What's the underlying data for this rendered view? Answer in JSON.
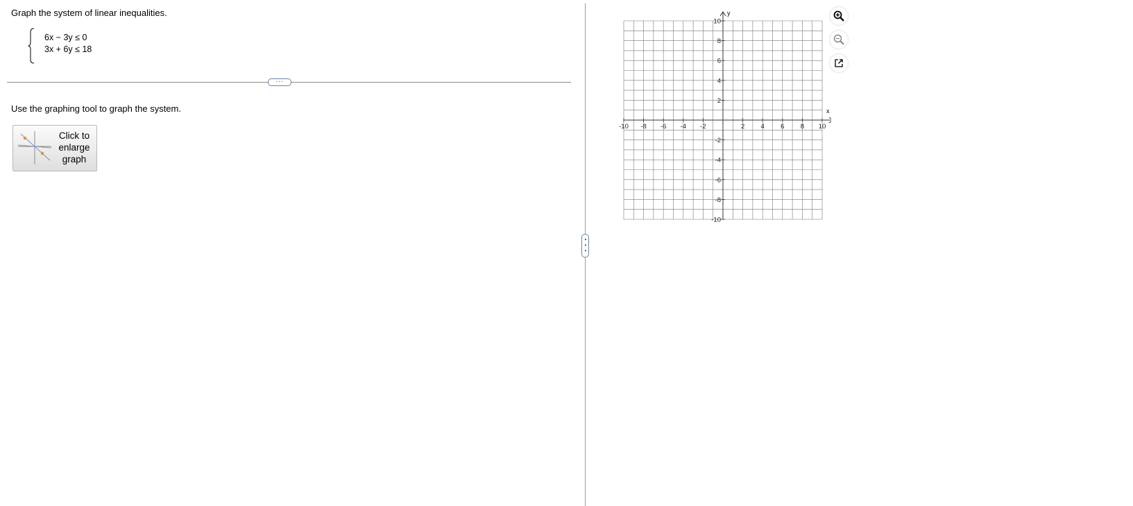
{
  "question": {
    "prompt": "Graph the system of linear inequalities.",
    "inequalities": [
      "6x − 3y ≤ 0",
      "3x + 6y ≤ 18"
    ],
    "instruction": "Use the graphing tool to graph the system.",
    "enlarge_button": [
      "Click to",
      "enlarge",
      "graph"
    ]
  },
  "divider": {
    "handle_label": "···"
  },
  "graph": {
    "x_label": "x",
    "y_label": "y",
    "x_ticks": [
      "-10",
      "-8",
      "-6",
      "-4",
      "-2",
      "2",
      "4",
      "6",
      "8",
      "10"
    ],
    "y_ticks": [
      "10",
      "8",
      "6",
      "4",
      "2",
      "-2",
      "-4",
      "-6",
      "-8",
      "-10"
    ],
    "x_range": [
      -10,
      10
    ],
    "y_range": [
      -10,
      10
    ],
    "grid_step": 1,
    "grid": true
  },
  "toolbar": {
    "zoom_in": "zoom-in-icon",
    "zoom_out": "zoom-out-icon",
    "popout": "popout-icon"
  },
  "colors": {
    "grid": "#777777",
    "axis": "#333333",
    "handle_border": "#6b84a8",
    "thumb_point": "#e8902c",
    "thumb_line": "#7a93b8"
  }
}
